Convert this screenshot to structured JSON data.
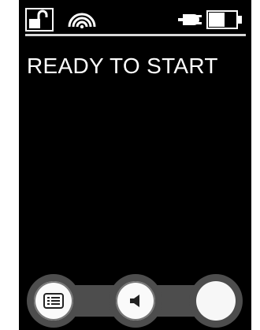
{
  "status": {
    "lock_icon": "unlocked-lock-icon",
    "wifi_icon": "wireless-signal-icon",
    "plug_icon": "power-plug-icon",
    "battery_icon": "battery-icon"
  },
  "main": {
    "message": "READY TO START"
  },
  "bottom_bar": {
    "buttons": [
      {
        "name": "menu-button",
        "icon": "list-card-icon"
      },
      {
        "name": "sound-button",
        "icon": "speaker-icon"
      },
      {
        "name": "start-button",
        "icon": ""
      }
    ]
  },
  "colors": {
    "screen_bg": "#000000",
    "text": "#ffffff",
    "bar": "#4d4d4d",
    "button": "#fafafa"
  }
}
